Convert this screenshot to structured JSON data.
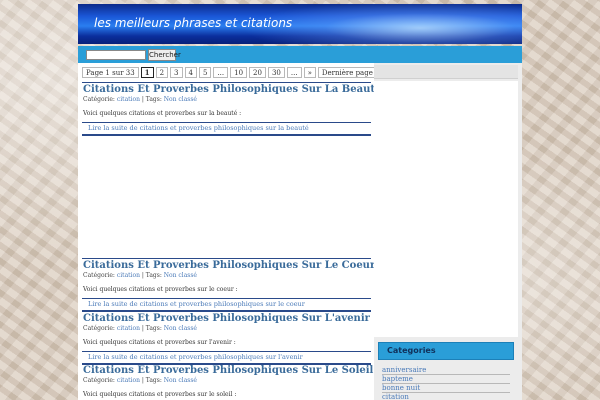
{
  "header": {
    "site_title": "les meilleurs phrases et citations"
  },
  "search": {
    "button_label": "Chercher",
    "value": ""
  },
  "pager": {
    "label": "Page 1 sur 33",
    "pages": [
      "1",
      "2",
      "3",
      "4",
      "5",
      "...",
      "10",
      "20",
      "30",
      "...",
      "»",
      "Dernière page »"
    ],
    "current": "1"
  },
  "posts": [
    {
      "title": "Citations Et Proverbes Philosophiques Sur La Beauté",
      "category_label": "Catégorie:",
      "category": "citation",
      "tags_label": "| Tags:",
      "tags": "Non classé",
      "excerpt": "Voici quelques citations et proverbes sur la beauté :",
      "read_more": "Lire la suite de citations et proverbes philosophiques sur la beauté"
    },
    {
      "title": "Citations Et Proverbes Philosophiques Sur Le Coeur",
      "category_label": "Catégorie:",
      "category": "citation",
      "tags_label": "| Tags:",
      "tags": "Non classé",
      "excerpt": "Voici quelques citations et proverbes sur le coeur :",
      "read_more": "Lire la suite de citations et proverbes philosophiques sur le coeur"
    },
    {
      "title": "Citations Et Proverbes Philosophiques Sur L'avenir",
      "category_label": "Catégorie:",
      "category": "citation",
      "tags_label": "| Tags:",
      "tags": "Non classé",
      "excerpt": "Voici quelques citations et proverbes sur l'avenir :",
      "read_more": "Lire la suite de citations et proverbes philosophiques sur l'avenir"
    },
    {
      "title": "Citations Et Proverbes Philosophiques Sur Le Soleil",
      "category_label": "Catégorie:",
      "category": "citation",
      "tags_label": "| Tags:",
      "tags": "Non classé",
      "excerpt": "Voici quelques citations et proverbes sur le soleil :"
    }
  ],
  "sidebar": {
    "categories_title": "Categories",
    "categories": [
      "anniversaire",
      "bapteme",
      "bonne nuit",
      "citation"
    ]
  },
  "colors": {
    "accent_blue": "#2a9ed8",
    "link_blue": "#4a7ab8",
    "title_blue": "#3a6b9a"
  }
}
